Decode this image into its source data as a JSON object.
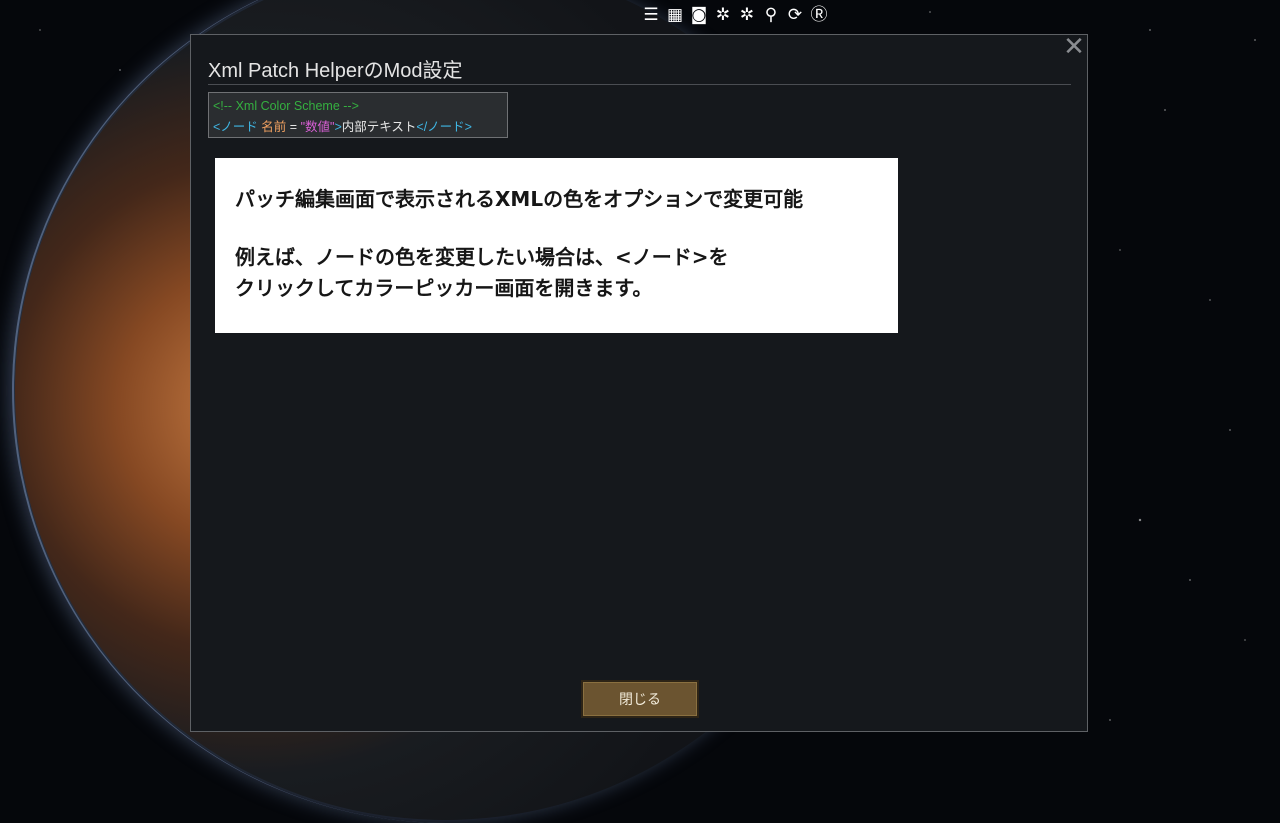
{
  "toolbar": {
    "icons": [
      {
        "name": "log-icon",
        "glyph": "☰"
      },
      {
        "name": "table-icon",
        "glyph": "▦"
      },
      {
        "name": "bucket-icon",
        "glyph": "◙"
      },
      {
        "name": "sparkle-icon",
        "glyph": "✲"
      },
      {
        "name": "sparkle-alt-icon",
        "glyph": "✲"
      },
      {
        "name": "search-icon",
        "glyph": "⚲"
      },
      {
        "name": "refresh-icon",
        "glyph": "⟳"
      },
      {
        "name": "reload-r-icon",
        "glyph": "Ⓡ"
      }
    ]
  },
  "window": {
    "title": "Xml Patch HelperのMod設定",
    "close_glyph": "✕",
    "scheme": {
      "comment": "<!-- Xml Color Scheme -->",
      "node_open": "<ノード",
      "attr_name": "名前",
      "equals": " = ",
      "value": "\"数値\"",
      "node_close_bracket": ">",
      "inner_text": "内部テキスト",
      "node_end": "</ノード>"
    },
    "info": {
      "line1": "パッチ編集画面で表示されるXMLの色をオプションで変更可能",
      "line2": "例えば、ノードの色を変更したい場合は、<ノード>を",
      "line3": "クリックしてカラーピッカー画面を開きます。"
    },
    "close_button": "閉じる"
  },
  "colors": {
    "comment": "#35b040",
    "node": "#3fb6e4",
    "attr": "#f0a060",
    "value": "#d95fd6",
    "text": "#e6e6e6",
    "button": "#6b5430"
  }
}
